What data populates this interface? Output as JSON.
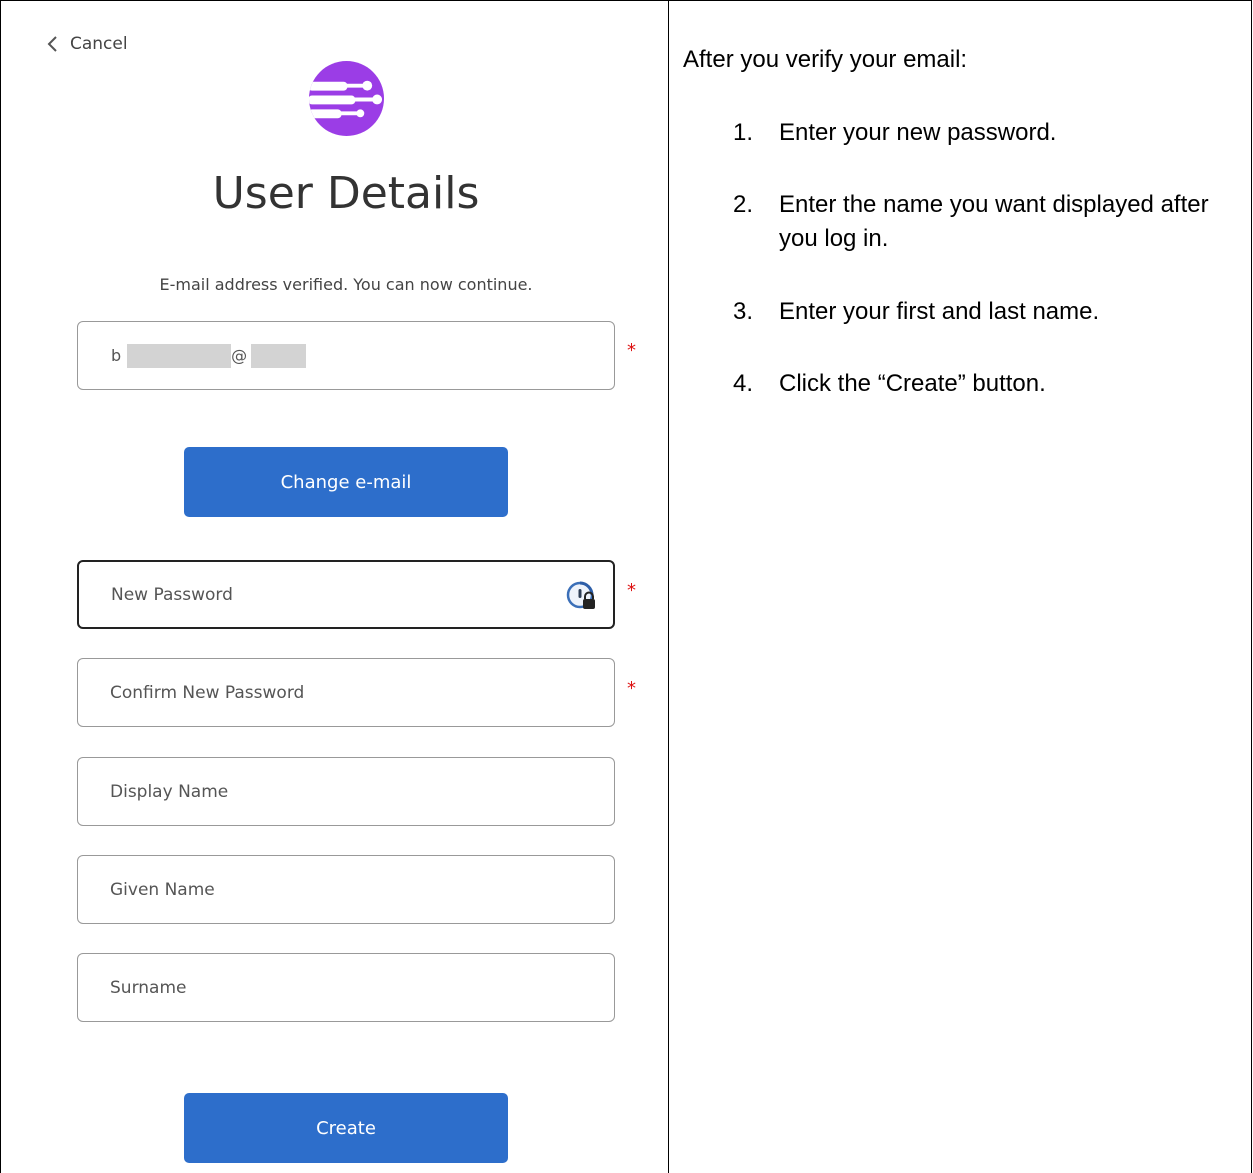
{
  "left": {
    "cancel_label": "Cancel",
    "title": "User Details",
    "verified_message": "E-mail address verified. You can now continue.",
    "email": {
      "prefix": "b",
      "at": "@"
    },
    "change_email_label": "Change e-mail",
    "fields": {
      "new_password_placeholder": "New Password",
      "confirm_password_placeholder": "Confirm New Password",
      "display_name_placeholder": "Display Name",
      "given_name_placeholder": "Given Name",
      "surname_placeholder": "Surname"
    },
    "required_mark": "*",
    "create_label": "Create"
  },
  "right": {
    "intro": "After you verify your email:",
    "steps": [
      {
        "num": "1.",
        "text": "Enter your new password."
      },
      {
        "num": "2.",
        "text": "Enter the name you want displayed after you log in."
      },
      {
        "num": "3.",
        "text": "Enter your first and last name."
      },
      {
        "num": "4.",
        "text": "Click the “Create” button."
      }
    ]
  },
  "colors": {
    "brand_purple": "#9b3de6",
    "button_blue": "#2d6ecb",
    "required_red": "#dd1111"
  },
  "icons": [
    "chevron-left-icon",
    "app-logo",
    "password-manager-icon"
  ]
}
